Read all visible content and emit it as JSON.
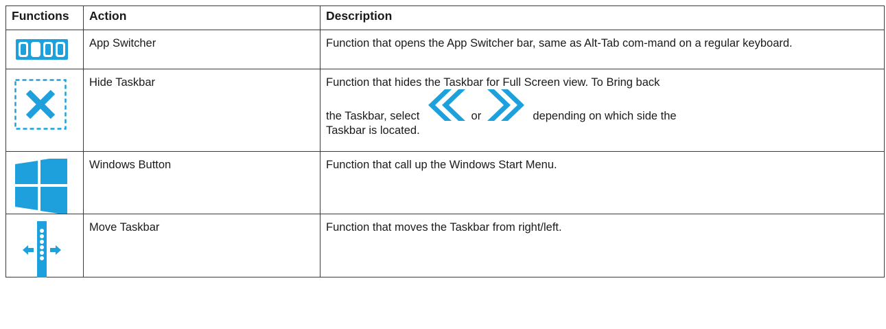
{
  "header": {
    "functions": "Functions",
    "action": "Action",
    "description": "Description"
  },
  "rows": [
    {
      "icon": "app-switcher-icon",
      "action": "App Switcher",
      "description": "Function that opens the App Switcher bar, same as Alt-Tab com-mand on a regular keyboard."
    },
    {
      "icon": "hide-taskbar-icon",
      "action": "Hide Taskbar",
      "description_line1": "Function that hides the Taskbar for Full Screen view. To Bring back",
      "description_pre": "the Taskbar, select",
      "description_or": "or",
      "description_post": "depending on which side the",
      "description_tail": "Taskbar is located."
    },
    {
      "icon": "windows-logo-icon",
      "action": "Windows Button",
      "description": "Function that call up the Windows Start Menu."
    },
    {
      "icon": "move-taskbar-icon",
      "action": "Move Taskbar",
      "description": "Function that moves the Taskbar from right/left."
    }
  ],
  "colors": {
    "icon_blue": "#1ea0dc",
    "border": "#3a3a3a"
  }
}
